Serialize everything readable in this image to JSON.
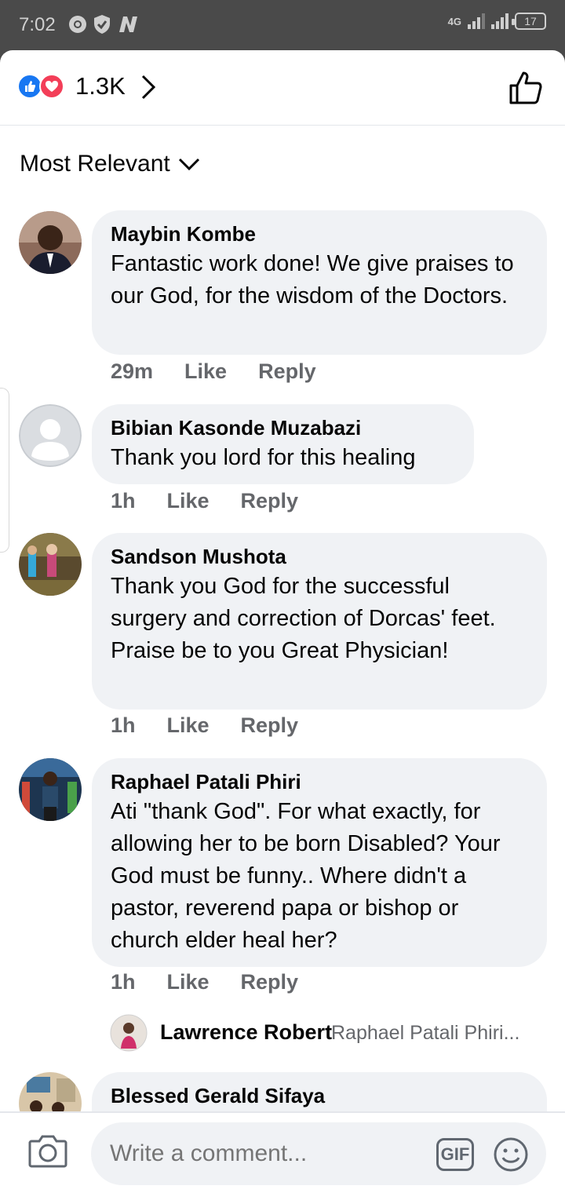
{
  "status": {
    "time": "7:02",
    "network": "4G",
    "battery": "17"
  },
  "reactions": {
    "count": "1.3K"
  },
  "sort": {
    "label": "Most Relevant"
  },
  "comments": [
    {
      "name": "Maybin Kombe",
      "text": "Fantastic work done! We give praises to our God, for the wisdom of the Doctors.",
      "time": "29m",
      "like": "Like",
      "reply": "Reply"
    },
    {
      "name": "Bibian Kasonde Muzabazi",
      "text": "Thank you lord for this healing",
      "time": "1h",
      "like": "Like",
      "reply": "Reply"
    },
    {
      "name": "Sandson Mushota",
      "text": "Thank you God for the successful surgery and correction of Dorcas' feet. Praise be to you Great Physician!",
      "time": "1h",
      "like": "Like",
      "reply": "Reply"
    },
    {
      "name": "Raphael Patali Phiri",
      "text": "Ati \"thank God\". For what exactly,  for allowing her to be born Disabled? Your God must be funny.. Where didn't a pastor, reverend papa or bishop or church elder heal her?",
      "time": "1h",
      "like": "Like",
      "reply": "Reply"
    },
    {
      "name": "Blessed Gerald Sifaya"
    }
  ],
  "reply_preview": {
    "name": "Lawrence Robert",
    "text": "Raphael Patali Phiri..."
  },
  "composer": {
    "placeholder": "Write a comment...",
    "gif": "GIF"
  }
}
